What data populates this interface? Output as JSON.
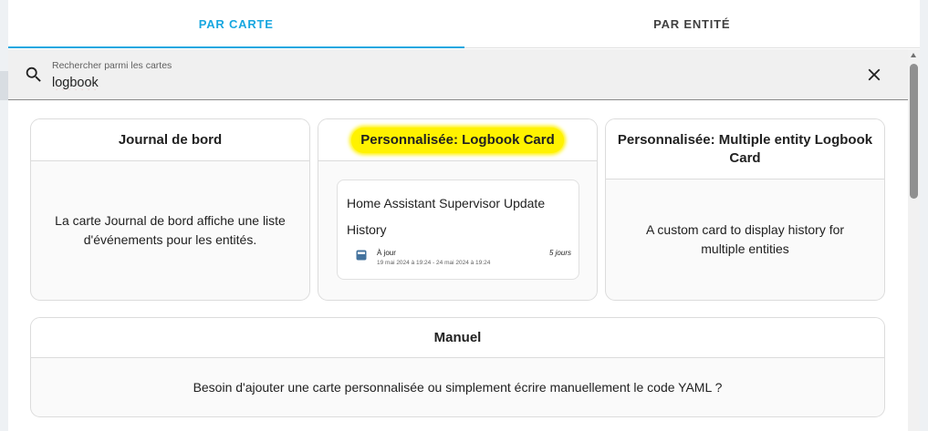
{
  "tabs": [
    {
      "label": "PAR CARTE",
      "active": true
    },
    {
      "label": "PAR ENTITÉ",
      "active": false
    }
  ],
  "search": {
    "label": "Rechercher parmi les cartes",
    "value": "logbook",
    "search_icon": "search-icon",
    "clear_icon": "close-icon"
  },
  "cards": [
    {
      "title": "Journal de bord",
      "description": "La carte Journal de bord affiche une liste d'événements pour les entités."
    },
    {
      "title": "Personnalisée: Logbook Card",
      "highlighted": true,
      "preview": {
        "title": "Home Assistant Supervisor Update History",
        "entry_icon": "update-icon",
        "entry_state": "À jour",
        "entry_duration": "5 jours",
        "entry_range": "19 mai 2024 à 19:24 - 24 mai 2024 à 19:24"
      }
    },
    {
      "title": "Personnalisée: Multiple entity Logbook Card",
      "description": "A custom card to display history for multiple entities"
    },
    {
      "title": "Manuel",
      "description": "Besoin d'ajouter une carte personnalisée ou simplement écrire manuellement le code YAML ?"
    }
  ],
  "colors": {
    "accent": "#18a7e0",
    "highlight": "#fff200",
    "entry_icon": "#44739e"
  }
}
